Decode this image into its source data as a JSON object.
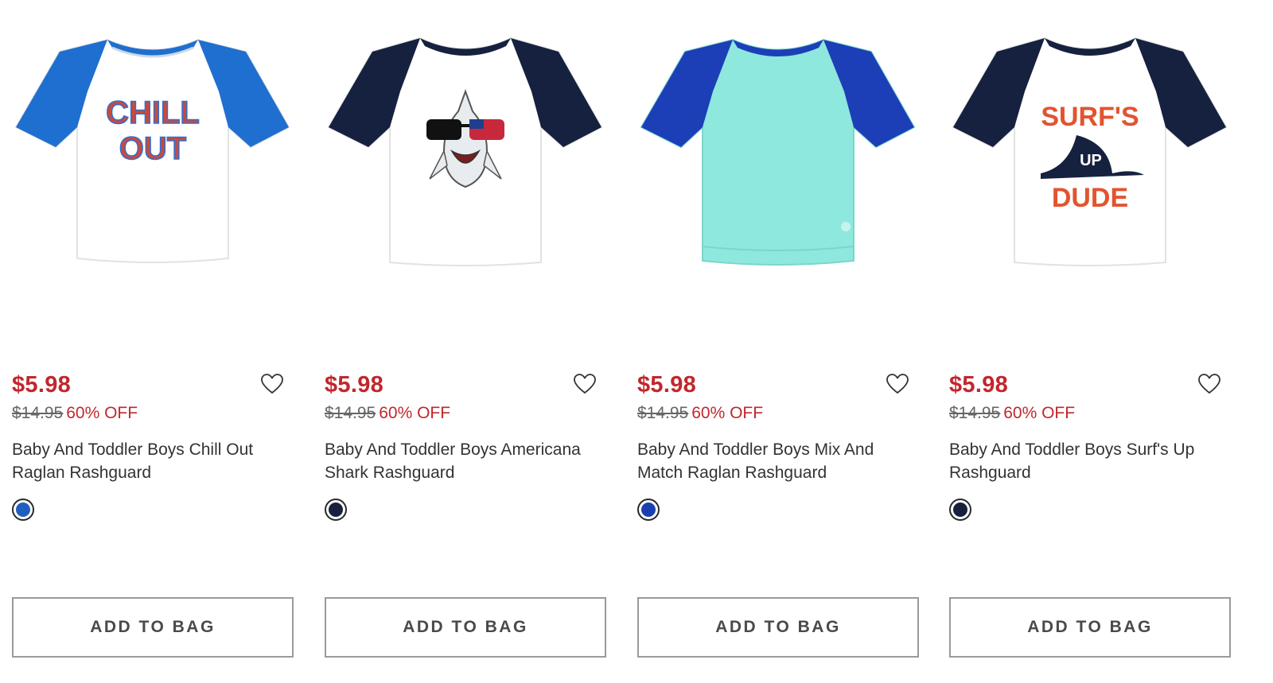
{
  "products": [
    {
      "sale_price": "$5.98",
      "original_price": "$14.95",
      "discount": "60% OFF",
      "name": "Baby And Toddler Boys Chill Out Raglan Rashguard",
      "swatch_color": "#1f5fbf",
      "button_label": "ADD TO BAG",
      "graphic_text": "CHILL OUT"
    },
    {
      "sale_price": "$5.98",
      "original_price": "$14.95",
      "discount": "60% OFF",
      "name": "Baby And Toddler Boys Americana Shark Rashguard",
      "swatch_color": "#17213d",
      "button_label": "ADD TO BAG"
    },
    {
      "sale_price": "$5.98",
      "original_price": "$14.95",
      "discount": "60% OFF",
      "name": "Baby And Toddler Boys Mix And Match Raglan Rashguard",
      "swatch_color": "#1a3fb0",
      "button_label": "ADD TO BAG"
    },
    {
      "sale_price": "$5.98",
      "original_price": "$14.95",
      "discount": "60% OFF",
      "name": "Baby And Toddler Boys Surf's Up Rashguard",
      "swatch_color": "#17213d",
      "button_label": "ADD TO BAG",
      "graphic_text_top": "SURF'S",
      "graphic_text_mid": "UP",
      "graphic_text_bottom": "DUDE"
    }
  ],
  "colors": {
    "price_red": "#c1272d",
    "text": "#333333",
    "muted": "#666666",
    "button_border": "#9a9a9a"
  }
}
